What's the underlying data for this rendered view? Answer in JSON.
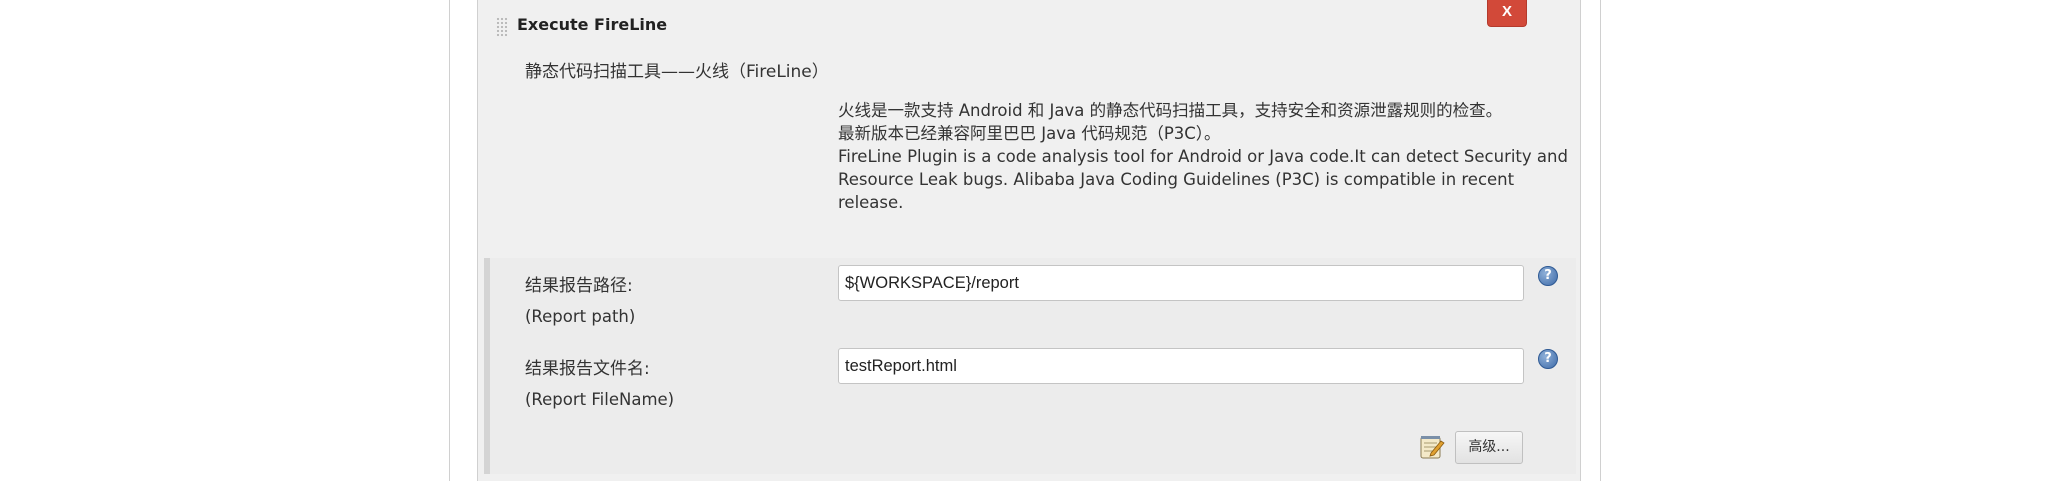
{
  "panel": {
    "title": "Execute FireLine",
    "delete_label": "X",
    "subtitle": "静态代码扫描工具——火线（FireLine）"
  },
  "description": {
    "lines": [
      "火线是一款支持 Android 和 Java 的静态代码扫描工具，支持安全和资源泄露规则的检查。",
      "最新版本已经兼容阿里巴巴 Java 代码规范（P3C）。",
      "FireLine Plugin is a code analysis tool for Android or Java code.It can detect Security and",
      "Resource Leak bugs. Alibaba Java Coding Guidelines (P3C) is compatible in recent",
      "release."
    ]
  },
  "fields": [
    {
      "label": "结果报告路径:",
      "sublabel": "(Report path)",
      "value": "${WORKSPACE}/report",
      "help_icon": "help-icon"
    },
    {
      "label": "结果报告文件名:",
      "sublabel": "(Report FileName)",
      "value": "testReport.html",
      "help_icon": "help-icon"
    }
  ],
  "footer": {
    "advanced_label": "高级...",
    "notepad_icon": "notepad-icon"
  },
  "colors": {
    "delete_button": "#d24939",
    "help_icon": "#3d6aa8",
    "panel_background": "#f0f0f0"
  }
}
